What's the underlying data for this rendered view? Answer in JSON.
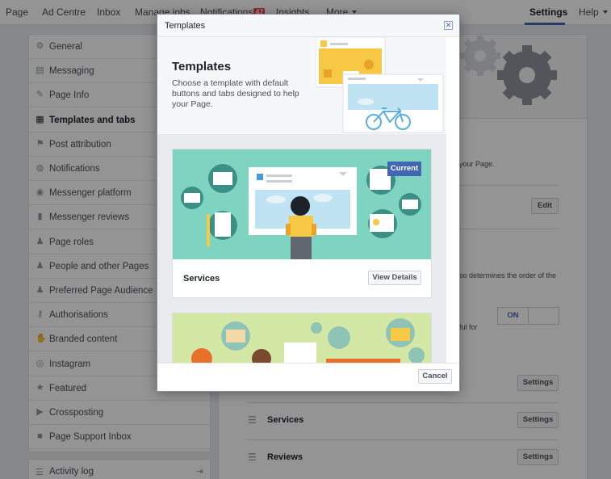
{
  "topnav": {
    "items": [
      "Page",
      "Ad Centre",
      "Inbox",
      "Manage jobs",
      "Notifications",
      "Insights",
      "More"
    ],
    "notifications_count": "47",
    "settings": "Settings",
    "help": "Help"
  },
  "sidebar": {
    "items": [
      {
        "label": "General",
        "icon": "gear-icon"
      },
      {
        "label": "Messaging",
        "icon": "chat-icon"
      },
      {
        "label": "Page Info",
        "icon": "pencil-icon"
      },
      {
        "label": "Templates and tabs",
        "icon": "grid-icon"
      },
      {
        "label": "Post attribution",
        "icon": "flag-icon"
      },
      {
        "label": "Notifications",
        "icon": "globe-icon"
      },
      {
        "label": "Messenger platform",
        "icon": "messenger-icon"
      },
      {
        "label": "Messenger reviews",
        "icon": "bars-icon"
      },
      {
        "label": "Page roles",
        "icon": "person-icon"
      },
      {
        "label": "People and other Pages",
        "icon": "people-icon"
      },
      {
        "label": "Preferred Page Audience",
        "icon": "audience-icon"
      },
      {
        "label": "Authorisations",
        "icon": "key-icon"
      },
      {
        "label": "Branded content",
        "icon": "handshake-icon"
      },
      {
        "label": "Instagram",
        "icon": "instagram-icon"
      },
      {
        "label": "Featured",
        "icon": "star-icon"
      },
      {
        "label": "Crossposting",
        "icon": "video-icon"
      },
      {
        "label": "Page Support Inbox",
        "icon": "facebook-icon"
      }
    ],
    "active_index": 3,
    "activity_log": "Activity log"
  },
  "main": {
    "fragment_your_page": "your Page.",
    "fragment_order": "so determines the order of the",
    "fragment_for1": "ful for",
    "fragment_for2": "",
    "edit_label": "Edit",
    "toggle_on": "ON",
    "tabs": [
      {
        "name": "",
        "button": "Settings"
      },
      {
        "name": "Services",
        "button": "Settings"
      },
      {
        "name": "Reviews",
        "button": "Settings"
      }
    ]
  },
  "dialog": {
    "title": "Templates",
    "heading": "Templates",
    "description": "Choose a template with default buttons and tabs designed to help your Page.",
    "cards": [
      {
        "name": "Services",
        "badge": "Current",
        "button": "View Details"
      }
    ],
    "cancel": "Cancel"
  },
  "colors": {
    "accent": "#4267b2",
    "teal": "#7fd3c1",
    "yellow": "#f7c844",
    "green_bg": "#d4e8a6"
  }
}
